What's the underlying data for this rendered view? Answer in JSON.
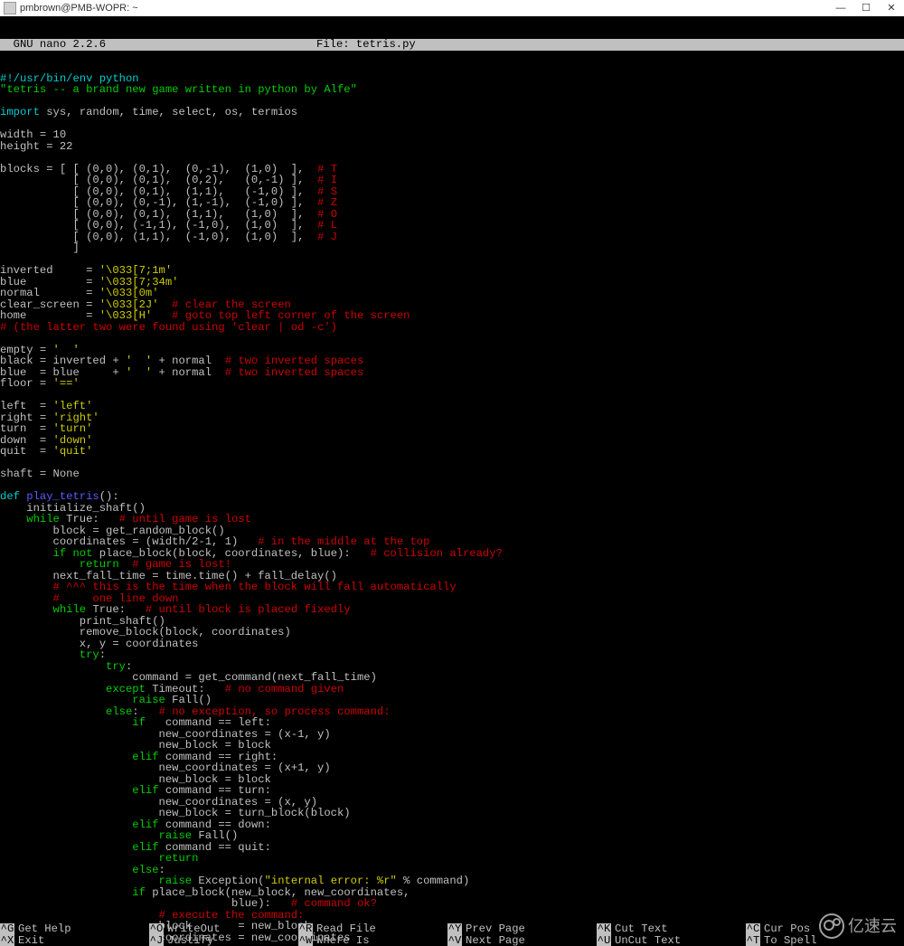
{
  "window": {
    "title": "pmbrown@PMB-WOPR: ~"
  },
  "header": {
    "left": "  GNU nano 2.2.6",
    "mid": "File: tetris.py"
  },
  "code": {
    "shebang": "#!/usr/bin/env python",
    "docstring": "\"tetris -- a brand new game written in python by Alfe\"",
    "import_kw": "import",
    "import_mods": " sys, random, time, select, os, termios",
    "width_line": "width = 10",
    "height_line": "height = 22",
    "blocks0a": "blocks = [ [ (0,0), (0,1),  (0,-1),  (1,0)  ],  ",
    "blocks0b": "# T",
    "blocks1a": "           [ (0,0), (0,1),  (0,2),   (0,-1) ],  ",
    "blocks1b": "# I",
    "blocks2a": "           [ (0,0), (0,1),  (1,1),   (-1,0) ],  ",
    "blocks2b": "# S",
    "blocks3a": "           [ (0,0), (0,-1), (1,-1),  (-1,0) ],  ",
    "blocks3b": "# Z",
    "blocks4a": "           [ (0,0), (0,1),  (1,1),   (1,0)  ],  ",
    "blocks4b": "# O",
    "blocks5a": "           [ (0,0), (-1,1), (-1,0),  (1,0)  ],  ",
    "blocks5b": "# L",
    "blocks6a": "           [ (0,0), (1,1),  (-1,0),  (1,0)  ],  ",
    "blocks6b": "# J",
    "blocks7": "           ]",
    "inv_a": "inverted     = ",
    "inv_b": "'\\033[7;1m'",
    "blue_a": "blue         = ",
    "blue_b": "'\\033[7;34m'",
    "norm_a": "normal       = ",
    "norm_b": "'\\033[0m'",
    "cls_a": "clear_screen = ",
    "cls_b": "'\\033[2J'",
    "cls_c": "  # clear the screen",
    "home_a": "home         = ",
    "home_b": "'\\033[H'",
    "home_c": "   # goto top left corner of the screen",
    "latter": "# (the latter two were found using 'clear | od -c')",
    "empty_a": "empty = ",
    "empty_b": "'  '",
    "black_a": "black = inverted + ",
    "black_b": "'  '",
    "black_c": " + normal  ",
    "black_d": "# two inverted spaces",
    "blue2_a": "blue  = blue     + ",
    "blue2_b": "'  '",
    "blue2_c": " + normal  ",
    "blue2_d": "# two inverted spaces",
    "floor_a": "floor = ",
    "floor_b": "'=='",
    "left_a": "left  = ",
    "left_b": "'left'",
    "right_a": "right = ",
    "right_b": "'right'",
    "turn_a": "turn  = ",
    "turn_b": "'turn'",
    "down_a": "down  = ",
    "down_b": "'down'",
    "quit_a": "quit  = ",
    "quit_b": "'quit'",
    "shaft": "shaft = None",
    "def": "def",
    "fn": " play_tetris",
    "paren": "():",
    "init": "    initialize_shaft()",
    "while1a": "    ",
    "while": "while",
    "while1b": " True:   ",
    "while1c": "# until game is lost",
    "blk_line": "        block = get_random_block()",
    "coord_a": "        coordinates = (width/2-1, 1)   ",
    "coord_b": "# in the middle at the top",
    "ifnot_a": "        ",
    "ifnot_b": "if not",
    "ifnot_c": " place_block(block, coordinates, blue):   ",
    "ifnot_d": "# collision already?",
    "ret1_a": "            ",
    "return": "return",
    "ret1_b": "  # game is lost!",
    "nft": "        next_fall_time = time.time() + fall_delay()",
    "cm1": "        # ^^^ this is the time when the block will fall automatically",
    "cm2": "        #     one line down",
    "while2a": "        ",
    "while2b": " True:   ",
    "while2c": "# until block is placed fixedly",
    "prsh": "            print_shaft()",
    "remb": "            remove_block(block, coordinates)",
    "xy": "            x, y = coordinates",
    "try": "try",
    "try1": "            ",
    "try1b": ":",
    "try2": "                ",
    "try2b": ":",
    "cmd": "                    command = get_command(next_fall_time)",
    "except": "except",
    "exc_a": "                ",
    "exc_b": " Timeout:   ",
    "exc_c": "# no command given",
    "raise": "raise",
    "raise1a": "                    ",
    "raise1b": " Fall()",
    "else": "else",
    "else1a": "                ",
    "else1b": ":   ",
    "else1c": "# no exception, so process command:",
    "if": "if",
    "if1a": "                    ",
    "if1b": "   command == left:",
    "nc1": "                        new_coordinates = (x-1, y)",
    "nb1": "                        new_block = block",
    "elif": "elif",
    "elif1a": "                    ",
    "elif1b": " command == right:",
    "nc2": "                        new_coordinates = (x+1, y)",
    "nb2": "                        new_block = block",
    "elif2b": " command == turn:",
    "nc3": "                        new_coordinates = (x, y)",
    "nb3": "                        new_block = turn_block(block)",
    "elif3b": " command == down:",
    "raise2b": " Fall()",
    "elif4b": " command == quit:",
    "ret2": "                        ",
    "else2b": ":",
    "raise3a": "                        ",
    "raise3b": " Exception(",
    "raise3c": "\"internal error: %r\"",
    "raise3d": " % command)",
    "if2a": "                    ",
    "if2b": " place_block(new_block, new_coordinates,",
    "if2c": "                                   blue):   ",
    "if2d": "# command ok?",
    "exec": "                        # execute the command:",
    "blk2": "                        block       = new_block",
    "coord2": "                        coordinates = new_coordinates"
  },
  "menu": {
    "items": [
      {
        "k": "^G",
        "l": "Get Help"
      },
      {
        "k": "^O",
        "l": "WriteOut"
      },
      {
        "k": "^R",
        "l": "Read File"
      },
      {
        "k": "^Y",
        "l": "Prev Page"
      },
      {
        "k": "^K",
        "l": "Cut Text"
      },
      {
        "k": "^C",
        "l": "Cur Pos"
      },
      {
        "k": "^X",
        "l": "Exit"
      },
      {
        "k": "^J",
        "l": "Justify"
      },
      {
        "k": "^W",
        "l": "Where Is"
      },
      {
        "k": "^V",
        "l": "Next Page"
      },
      {
        "k": "^U",
        "l": "UnCut Text"
      },
      {
        "k": "^T",
        "l": "To Spell"
      }
    ]
  },
  "watermark": "亿速云"
}
